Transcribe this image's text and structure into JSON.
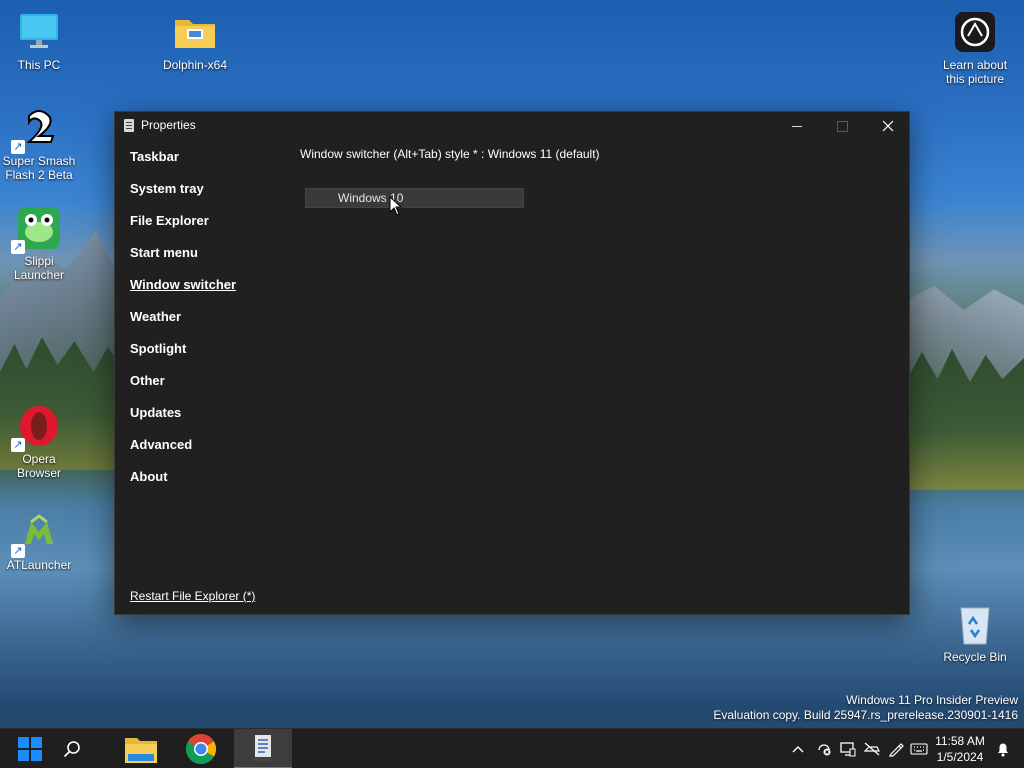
{
  "desktop": {
    "icons": [
      {
        "label": "This PC"
      },
      {
        "label": "Dolphin-x64"
      },
      {
        "label": "Learn about this picture"
      },
      {
        "label": "Super Smash Flash 2 Beta"
      },
      {
        "label": "Slippi Launcher"
      },
      {
        "label": "Opera Browser"
      },
      {
        "label": "ATLauncher"
      },
      {
        "label": "Recycle Bin"
      }
    ]
  },
  "window": {
    "title": "Properties",
    "nav": [
      {
        "label": "Taskbar"
      },
      {
        "label": "System tray"
      },
      {
        "label": "File Explorer"
      },
      {
        "label": "Start menu"
      },
      {
        "label": "Window switcher",
        "active": true
      },
      {
        "label": "Weather"
      },
      {
        "label": "Spotlight"
      },
      {
        "label": "Other"
      },
      {
        "label": "Updates"
      },
      {
        "label": "Advanced"
      },
      {
        "label": "About"
      }
    ],
    "setting_label": "Window switcher (Alt+Tab) style * : Windows 11 (default)",
    "dropdown_value": "Windows 10",
    "restart_link": "Restart File Explorer (*)"
  },
  "watermark": {
    "line1": "Windows 11 Pro Insider Preview",
    "line2": "Evaluation copy. Build 25947.rs_prerelease.230901-1416"
  },
  "taskbar": {
    "items": [
      "windows-start-icon",
      "search-icon",
      "file-explorer-icon",
      "chrome-icon",
      "properties-app-icon"
    ],
    "tray": [
      "chevron-up-icon",
      "security-icon",
      "display-icon",
      "network-off-icon",
      "pen-icon",
      "keyboard-icon"
    ],
    "time": "11:58 AM",
    "date": "1/5/2024",
    "notification_icon": "bell-icon"
  },
  "colors": {
    "window_bg": "#202020",
    "taskbar_bg": "#1f1f1f",
    "dropdown_bg": "#3a3a3a",
    "start_blue": "#1a8cff"
  }
}
